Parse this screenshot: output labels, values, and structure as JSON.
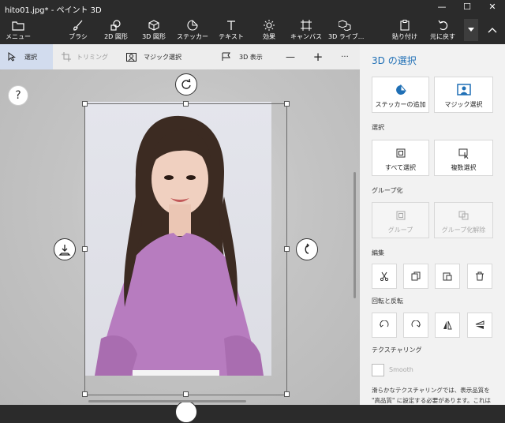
{
  "window": {
    "title": "hito01.jpg* - ペイント 3D",
    "minimize": "—",
    "maximize": "☐",
    "close": "✕"
  },
  "ribbon": {
    "menu": "メニュー",
    "brush": "ブラシ",
    "shapes2d": "2D 図形",
    "shapes3d": "3D 図形",
    "stickers": "ステッカー",
    "text": "テキスト",
    "effects": "効果",
    "canvas": "キャンバス",
    "library3d": "3D ライブ...",
    "paste": "貼り付け",
    "undo": "元に戻す"
  },
  "toolbar": {
    "select": "選択",
    "crop": "トリミング",
    "magic_select": "マジック選択",
    "view3d": "3D 表示",
    "zoom_out": "—",
    "zoom_in": "+",
    "more": "···"
  },
  "canvas": {
    "help": "?"
  },
  "panel": {
    "title": "3D の選択",
    "add_sticker": "ステッカーの追加",
    "magic_select": "マジック選択",
    "section_select": "選択",
    "select_all": "すべて選択",
    "multi_select": "複数選択",
    "section_group": "グループ化",
    "group": "グループ",
    "ungroup": "グループ化解除",
    "section_edit": "編集",
    "section_rotate": "回転と反転",
    "section_texture": "テクスチャリング",
    "smooth": "Smooth",
    "note_line1": "滑らかなテクスチャリングでは、表示品質を",
    "note_line2": "\"高品質\" に設定する必要があります。これは"
  },
  "colors": {
    "accent": "#1f6fb5",
    "chrome": "#2b2b2b",
    "panel": "#f2f2f2",
    "toolbar_active": "#d2dcee",
    "blouse": "#b77cbf"
  }
}
